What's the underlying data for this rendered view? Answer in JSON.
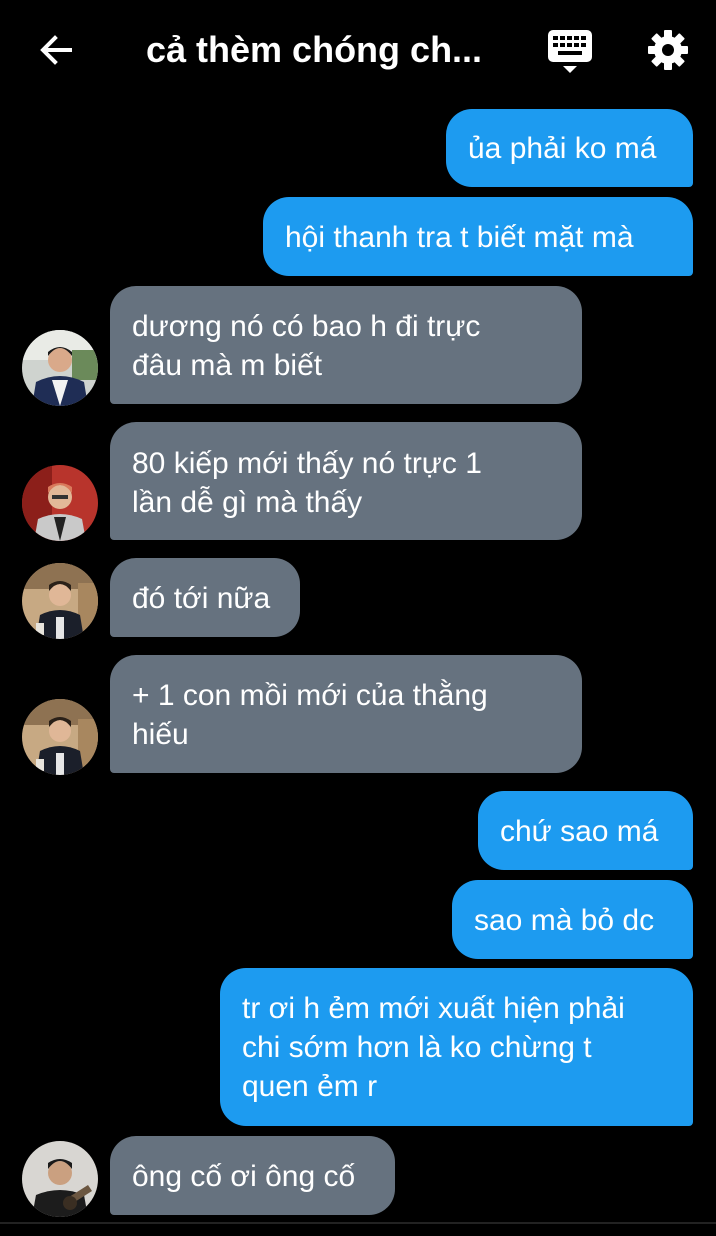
{
  "header": {
    "title": "cả thèm chóng ch...",
    "back_icon": "arrow-left-icon",
    "keyboard_icon": "keyboard-icon",
    "settings_icon": "gear-icon"
  },
  "colors": {
    "outgoing_bubble": "#1d9bf0",
    "incoming_bubble": "#66727f",
    "background": "#000000"
  },
  "messages": [
    {
      "direction": "out",
      "lines": [
        "ủa phải ko má"
      ]
    },
    {
      "direction": "out",
      "lines": [
        "hội thanh tra t biết mặt mà"
      ]
    },
    {
      "direction": "in",
      "lines": [
        "dương nó có bao h đi trực",
        "đâu mà m biết"
      ],
      "avatar": "avatar-1"
    },
    {
      "direction": "in",
      "lines": [
        "80 kiếp mới thấy nó trực 1",
        "lần dễ gì mà thấy"
      ],
      "avatar": "avatar-2"
    },
    {
      "direction": "in",
      "lines": [
        "đó tới nữa"
      ],
      "avatar": "avatar-3"
    },
    {
      "direction": "in",
      "lines": [
        "+ 1 con mồi mới của thằng",
        "hiếu"
      ],
      "avatar": "avatar-3"
    },
    {
      "direction": "out",
      "lines": [
        "chứ sao má"
      ]
    },
    {
      "direction": "out",
      "lines": [
        "sao mà bỏ dc"
      ]
    },
    {
      "direction": "out",
      "lines": [
        "tr ơi h ẻm mới xuất hiện phải",
        "chi sớm hơn là ko chừng t",
        "quen ẻm r"
      ]
    },
    {
      "direction": "in",
      "lines": [
        "ông cố ơi ông cố"
      ],
      "avatar": "avatar-4"
    }
  ]
}
